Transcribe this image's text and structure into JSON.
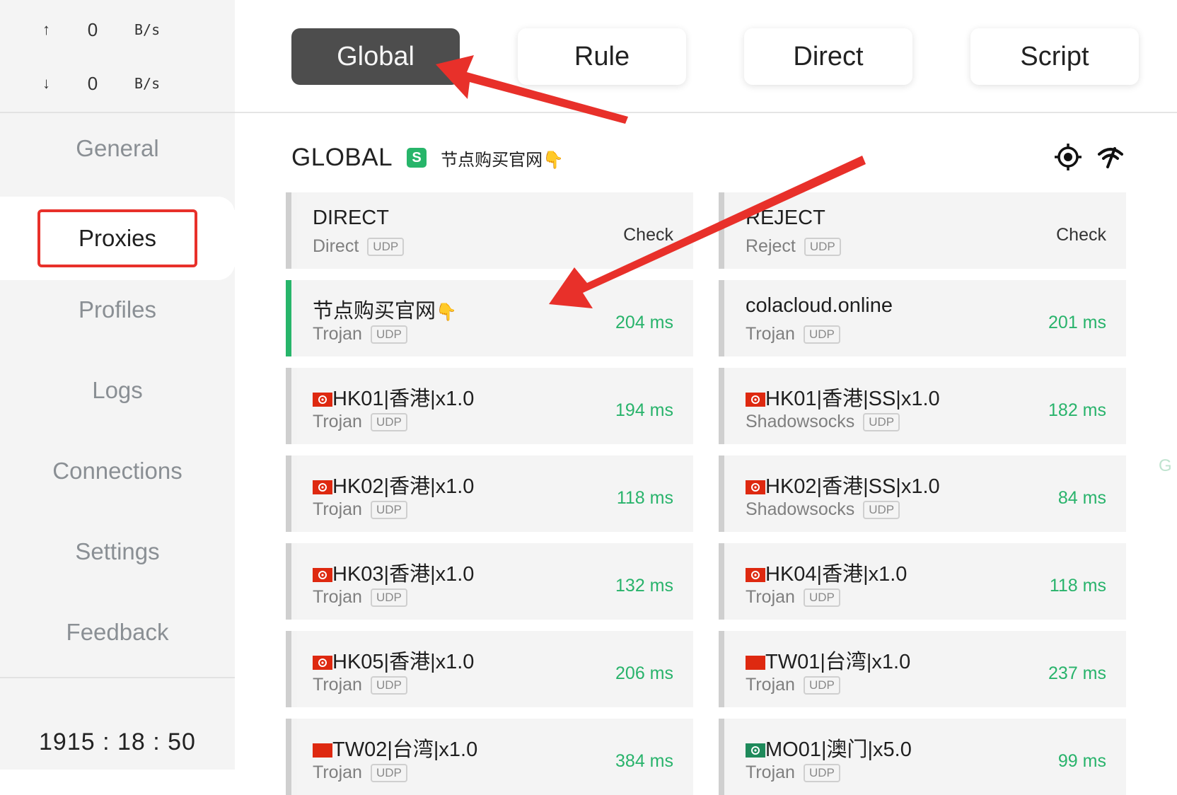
{
  "traffic": {
    "up": {
      "arrow": "↑",
      "value": "0",
      "unit": "B/s"
    },
    "down": {
      "arrow": "↓",
      "value": "0",
      "unit": "B/s"
    }
  },
  "sidebar": {
    "items": [
      {
        "label": "General"
      },
      {
        "label": "Proxies",
        "active": true
      },
      {
        "label": "Profiles"
      },
      {
        "label": "Logs"
      },
      {
        "label": "Connections"
      },
      {
        "label": "Settings"
      },
      {
        "label": "Feedback"
      }
    ],
    "uptime": "1915 : 18 : 50"
  },
  "modes": {
    "global": "Global",
    "rule": "Rule",
    "direct": "Direct",
    "script": "Script",
    "active": "Global"
  },
  "group": {
    "name": "GLOBAL",
    "type_badge": "S",
    "now": "节点购买官网",
    "icons": [
      "locate-icon",
      "latency-test-icon"
    ]
  },
  "proxies": [
    {
      "name": "DIRECT",
      "type": "Direct",
      "udp": "UDP",
      "delay": "Check",
      "flag": ""
    },
    {
      "name": "REJECT",
      "type": "Reject",
      "udp": "UDP",
      "delay": "Check",
      "flag": ""
    },
    {
      "name": "节点购买官网",
      "type": "Trojan",
      "udp": "UDP",
      "delay": "204 ms",
      "flag": "",
      "selected": true,
      "hand": true
    },
    {
      "name": "colacloud.online",
      "type": "Trojan",
      "udp": "UDP",
      "delay": "201 ms",
      "flag": ""
    },
    {
      "name": "HK01|香港|x1.0",
      "type": "Trojan",
      "udp": "UDP",
      "delay": "194 ms",
      "flag": "hk"
    },
    {
      "name": "HK01|香港|SS|x1.0",
      "type": "Shadowsocks",
      "udp": "UDP",
      "delay": "182 ms",
      "flag": "hk"
    },
    {
      "name": "HK02|香港|x1.0",
      "type": "Trojan",
      "udp": "UDP",
      "delay": "118 ms",
      "flag": "hk"
    },
    {
      "name": "HK02|香港|SS|x1.0",
      "type": "Shadowsocks",
      "udp": "UDP",
      "delay": "84 ms",
      "flag": "hk"
    },
    {
      "name": "HK03|香港|x1.0",
      "type": "Trojan",
      "udp": "UDP",
      "delay": "132 ms",
      "flag": "hk"
    },
    {
      "name": "HK04|香港|x1.0",
      "type": "Trojan",
      "udp": "UDP",
      "delay": "118 ms",
      "flag": "hk"
    },
    {
      "name": "HK05|香港|x1.0",
      "type": "Trojan",
      "udp": "UDP",
      "delay": "206 ms",
      "flag": "hk"
    },
    {
      "name": "TW01|台湾|x1.0",
      "type": "Trojan",
      "udp": "UDP",
      "delay": "237 ms",
      "flag": "tw"
    },
    {
      "name": "TW02|台湾|x1.0",
      "type": "Trojan",
      "udp": "UDP",
      "delay": "384 ms",
      "flag": "tw"
    },
    {
      "name": "MO01|澳门|x5.0",
      "type": "Trojan",
      "udp": "UDP",
      "delay": "99 ms",
      "flag": "mo"
    }
  ],
  "edge_letter": "G",
  "colors": {
    "accent_green": "#27b56a",
    "active_tab": "#4d4d4d",
    "annotation_red": "#e8302a"
  }
}
